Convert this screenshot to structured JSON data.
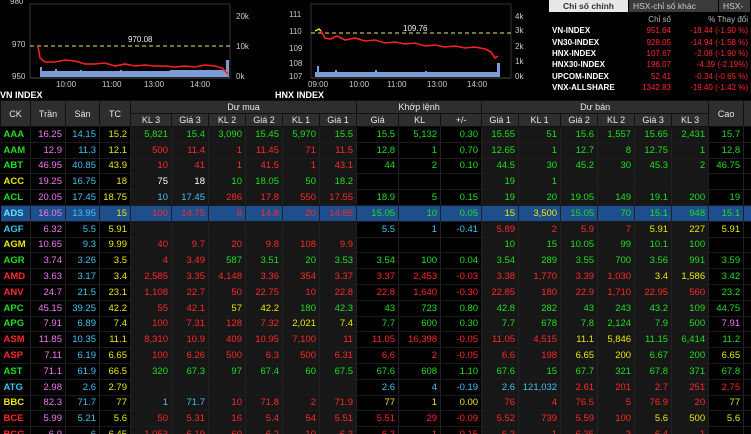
{
  "charts": [
    {
      "id": "vn",
      "label": "VN INDEX",
      "ref_value": "970.08",
      "y_left": [
        "980",
        "970",
        "960",
        "950"
      ],
      "y_right": [
        "20k",
        "15k",
        "10k",
        "5k",
        "0k"
      ],
      "x_ticks": [
        "10:00",
        "11:00",
        "13:00",
        "14:00"
      ]
    },
    {
      "id": "hnx",
      "label": "HNX INDEX",
      "ref_value": "109.76",
      "y_left": [
        "111",
        "110",
        "109",
        "108",
        "107"
      ],
      "y_right": [
        "4k",
        "3k",
        "2k",
        "1k",
        "0k"
      ],
      "x_ticks": [
        "09:00",
        "10:00",
        "11:00",
        "13:00",
        "14:00"
      ]
    }
  ],
  "index_panel": {
    "tabs": [
      "Chỉ số chính",
      "HSX-chỉ số khác",
      "HSX-"
    ],
    "headers": [
      "",
      "Chỉ số",
      "% Thay đổi"
    ],
    "rows": [
      {
        "name": "VN-INDEX",
        "value": "951.64",
        "change": "-18.44 (-1.90 %)"
      },
      {
        "name": "VN30-INDEX",
        "value": "928.05",
        "change": "-14.94 (-1.58 %)"
      },
      {
        "name": "HNX-INDEX",
        "value": "107.67",
        "change": "-2.08 (-1.90 %)"
      },
      {
        "name": "HNX30-INDEX",
        "value": "196.07",
        "change": "-4.39 (-2.19%)"
      },
      {
        "name": "UPCOM-INDEX",
        "value": "52.41",
        "change": "-0.34 (-0.65 %)"
      },
      {
        "name": "VNX-ALLSHARE",
        "value": "1342.83",
        "change": "-19.40 (-1.42 %)"
      }
    ]
  },
  "board": {
    "group_headers": {
      "buy": "Dư mua",
      "match": "Khớp lệnh",
      "sell": "Dư bán"
    },
    "col_headers": {
      "ck": "CK",
      "ceil": "Trần",
      "floor": "Sàn",
      "ref": "TC",
      "b3q": "KL 3",
      "b3p": "Giá 3",
      "b2q": "KL 2",
      "b2p": "Giá 2",
      "b1q": "KL 1",
      "b1p": "Giá 1",
      "mp": "Giá",
      "mq": "KL",
      "chg": "+/-",
      "s1p": "Giá 1",
      "s1q": "KL 1",
      "s2p": "Giá 2",
      "s2q": "KL 2",
      "s3p": "Giá 3",
      "s3q": "KL 3",
      "high": "Cao",
      "low": "T"
    },
    "rows": [
      {
        "ck": "AAA",
        "ceil": "16.25",
        "floor": "14.15",
        "ref": "15.2",
        "b3q": "5,821",
        "b3p": "15.4",
        "b2q": "3,090",
        "b2p": "15.45",
        "b1q": "5,970",
        "b1p": "15.5",
        "mp": "15.5",
        "mq": "5,132",
        "chg": "0.30",
        "s1p": "15.55",
        "s1q": "51",
        "s2p": "15.6",
        "s2q": "1,557",
        "s3p": "15.65",
        "s3q": "2,431",
        "high": "15.7",
        "low": "1",
        "c": {
          "ck": "up",
          "b3": "up",
          "b2": "up",
          "b1": "up",
          "m": "up",
          "s1": "up",
          "s2": "up",
          "s3": "up",
          "high": "up",
          "low": "up"
        }
      },
      {
        "ck": "AAM",
        "ceil": "12.9",
        "floor": "11.3",
        "ref": "12.1",
        "b3q": "500",
        "b3p": "11.4",
        "b2q": "1",
        "b2p": "11.45",
        "b1q": "71",
        "b1p": "11.5",
        "mp": "12.8",
        "mq": "1",
        "chg": "0.70",
        "s1p": "12.65",
        "s1q": "1",
        "s2p": "12.7",
        "s2q": "8",
        "s3p": "12.75",
        "s3q": "1",
        "high": "12.8",
        "low": "1",
        "c": {
          "ck": "up",
          "b3": "dn",
          "b2": "dn",
          "b1": "dn",
          "m": "up",
          "s1": "up",
          "s2": "up",
          "s3": "up",
          "high": "up",
          "low": "up"
        }
      },
      {
        "ck": "ABT",
        "ceil": "46.95",
        "floor": "40.85",
        "ref": "43.9",
        "b3q": "10",
        "b3p": "41",
        "b2q": "1",
        "b2p": "41.5",
        "b1q": "1",
        "b1p": "43.1",
        "mp": "44",
        "mq": "2",
        "chg": "0.10",
        "s1p": "44.5",
        "s1q": "30",
        "s2p": "45.2",
        "s2q": "30",
        "s3p": "45.3",
        "s3q": "2",
        "high": "46.75",
        "low": "4",
        "c": {
          "ck": "up",
          "b3": "dn",
          "b2": "dn",
          "b1": "dn",
          "m": "up",
          "s1": "up",
          "s2": "up",
          "s3": "up",
          "high": "up",
          "low": "up"
        }
      },
      {
        "ck": "ACC",
        "ceil": "19.25",
        "floor": "16.75",
        "ref": "18",
        "b3q": "75",
        "b3p": "18",
        "b2q": "10",
        "b2p": "18.05",
        "b1q": "50",
        "b1p": "18.2",
        "mp": "",
        "mq": "",
        "chg": "",
        "s1p": "19",
        "s1q": "1",
        "s2p": "",
        "s2q": "",
        "s3p": "",
        "s3q": "",
        "high": "",
        "low": "",
        "c": {
          "ck": "eq",
          "b3": "white",
          "b2": "up",
          "b1": "up",
          "m": "up",
          "s1": "up",
          "s2": "up",
          "s3": "up",
          "high": "up",
          "low": "up"
        }
      },
      {
        "ck": "ACL",
        "ceil": "20.05",
        "floor": "17.45",
        "ref": "18.75",
        "b3q": "10",
        "b3p": "17.45",
        "b2q": "286",
        "b2p": "17.8",
        "b1q": "550",
        "b1p": "17.55",
        "mp": "18.9",
        "mq": "5",
        "chg": "0.15",
        "s1p": "19",
        "s1q": "20",
        "s2p": "19.05",
        "s2q": "149",
        "s3p": "19.1",
        "s3q": "200",
        "high": "19",
        "low": "1",
        "c": {
          "ck": "up",
          "b3": "floor",
          "b2": "dn",
          "b1": "dn",
          "m": "up",
          "s1": "up",
          "s2": "up",
          "s3": "up",
          "high": "up",
          "low": "up"
        }
      },
      {
        "ck": "ADS",
        "ceil": "16.05",
        "floor": "13.95",
        "ref": "15",
        "b3q": "100",
        "b3p": "14.75",
        "b2q": "8",
        "b2p": "14.8",
        "b1q": "20",
        "b1p": "14.85",
        "mp": "15.05",
        "mq": "10",
        "chg": "0.05",
        "s1p": "15",
        "s1q": "3,500",
        "s2p": "15.05",
        "s2q": "70",
        "s3p": "15.1",
        "s3q": "948",
        "high": "15.1",
        "low": "1",
        "sel": true,
        "c": {
          "ck": "up",
          "b3": "dn",
          "b2": "dn",
          "b1": "dn",
          "m": "up",
          "s1": "eq",
          "s2": "up",
          "s3": "up",
          "high": "up",
          "low": "up"
        }
      },
      {
        "ck": "AGF",
        "ceil": "6.32",
        "floor": "5.5",
        "ref": "5.91",
        "b3q": "",
        "b3p": "",
        "b2q": "",
        "b2p": "",
        "b1q": "",
        "b1p": "",
        "mp": "5.5",
        "mq": "1",
        "chg": "-0.41",
        "s1p": "5.89",
        "s1q": "2",
        "s2p": "5.9",
        "s2q": "7",
        "s3p": "5.91",
        "s3q": "227",
        "high": "5.91",
        "low": "",
        "c": {
          "ck": "floor",
          "b3": "dn",
          "b2": "dn",
          "b1": "dn",
          "m": "floor",
          "s1": "dn",
          "s2": "dn",
          "s3": "eq",
          "high": "eq",
          "low": "eq"
        }
      },
      {
        "ck": "AGM",
        "ceil": "10.65",
        "floor": "9.3",
        "ref": "9.99",
        "b3q": "40",
        "b3p": "9.7",
        "b2q": "20",
        "b2p": "9.8",
        "b1q": "108",
        "b1p": "9.9",
        "mp": "",
        "mq": "",
        "chg": "",
        "s1p": "10",
        "s1q": "15",
        "s2p": "10.05",
        "s2q": "99",
        "s3p": "10.1",
        "s3q": "100",
        "high": "",
        "low": "",
        "c": {
          "ck": "eq",
          "b3": "dn",
          "b2": "dn",
          "b1": "dn",
          "m": "up",
          "s1": "up",
          "s2": "up",
          "s3": "up",
          "high": "up",
          "low": "up"
        }
      },
      {
        "ck": "AGR",
        "ceil": "3.74",
        "floor": "3.26",
        "ref": "3.5",
        "b3q": "4",
        "b3p": "3.49",
        "b2q": "587",
        "b2p": "3.51",
        "b1q": "20",
        "b1p": "3.53",
        "mp": "3.54",
        "mq": "100",
        "chg": "0.04",
        "s1p": "3.54",
        "s1q": "289",
        "s2p": "3.55",
        "s2q": "700",
        "s3p": "3.56",
        "s3q": "991",
        "high": "3.59",
        "low": "3",
        "c": {
          "ck": "up",
          "b3": "dn",
          "b2": "up",
          "b1": "up",
          "m": "up",
          "s1": "up",
          "s2": "up",
          "s3": "up",
          "high": "up",
          "low": "up"
        }
      },
      {
        "ck": "AMD",
        "ceil": "3.63",
        "floor": "3.17",
        "ref": "3.4",
        "b3q": "2,585",
        "b3p": "3.35",
        "b2q": "4,148",
        "b2p": "3.36",
        "b1q": "354",
        "b1p": "3.37",
        "mp": "3.37",
        "mq": "2,453",
        "chg": "-0.03",
        "s1p": "3.38",
        "s1q": "1,770",
        "s2p": "3.39",
        "s2q": "1,030",
        "s3p": "3.4",
        "s3q": "1,586",
        "high": "3.42",
        "low": "3",
        "c": {
          "ck": "dn",
          "b3": "dn",
          "b2": "dn",
          "b1": "dn",
          "m": "dn",
          "s1": "dn",
          "s2": "dn",
          "s3": "eq",
          "high": "up",
          "low": "dn"
        }
      },
      {
        "ck": "ANV",
        "ceil": "24.7",
        "floor": "21.5",
        "ref": "23.1",
        "b3q": "1,108",
        "b3p": "22.7",
        "b2q": "50",
        "b2p": "22.75",
        "b1q": "10",
        "b1p": "22.8",
        "mp": "22.8",
        "mq": "1,640",
        "chg": "-0.30",
        "s1p": "22.85",
        "s1q": "180",
        "s2p": "22.9",
        "s2q": "1,710",
        "s3p": "22.95",
        "s3q": "560",
        "high": "23.2",
        "low": "2",
        "c": {
          "ck": "dn",
          "b3": "dn",
          "b2": "dn",
          "b1": "dn",
          "m": "dn",
          "s1": "dn",
          "s2": "dn",
          "s3": "dn",
          "high": "up",
          "low": "dn"
        }
      },
      {
        "ck": "APC",
        "ceil": "45.15",
        "floor": "39.25",
        "ref": "42.2",
        "b3q": "55",
        "b3p": "42.1",
        "b2q": "57",
        "b2p": "42.2",
        "b1q": "180",
        "b1p": "42.3",
        "mp": "43",
        "mq": "723",
        "chg": "0.80",
        "s1p": "42.8",
        "s1q": "282",
        "s2p": "43",
        "s2q": "243",
        "s3p": "43.2",
        "s3q": "109",
        "high": "44.75",
        "low": "4",
        "c": {
          "ck": "up",
          "b3": "dn",
          "b2": "eq",
          "b1": "up",
          "m": "up",
          "s1": "up",
          "s2": "up",
          "s3": "up",
          "high": "up",
          "low": "up"
        }
      },
      {
        "ck": "APG",
        "ceil": "7.91",
        "floor": "6.89",
        "ref": "7.4",
        "b3q": "100",
        "b3p": "7.31",
        "b2q": "128",
        "b2p": "7.32",
        "b1q": "2,021",
        "b1p": "7.4",
        "mp": "7.7",
        "mq": "600",
        "chg": "0.30",
        "s1p": "7.7",
        "s1q": "678",
        "s2p": "7.8",
        "s2q": "2,124",
        "s3p": "7.9",
        "s3q": "500",
        "high": "7.91",
        "low": "7",
        "c": {
          "ck": "up",
          "b3": "dn",
          "b2": "dn",
          "b1": "eq",
          "m": "up",
          "s1": "up",
          "s2": "up",
          "s3": "up",
          "high": "ceil",
          "low": "up"
        }
      },
      {
        "ck": "ASM",
        "ceil": "11.85",
        "floor": "10.35",
        "ref": "11.1",
        "b3q": "8,310",
        "b3p": "10.9",
        "b2q": "409",
        "b2p": "10.95",
        "b1q": "7,100",
        "b1p": "11",
        "mp": "11.05",
        "mq": "16,398",
        "chg": "-0.05",
        "s1p": "11.05",
        "s1q": "4,515",
        "s2p": "11.1",
        "s2q": "5,846",
        "s3p": "11.15",
        "s3q": "6,414",
        "high": "11.2",
        "low": "1",
        "c": {
          "ck": "dn",
          "b3": "dn",
          "b2": "dn",
          "b1": "dn",
          "m": "dn",
          "s1": "dn",
          "s2": "eq",
          "s3": "up",
          "high": "up",
          "low": "dn"
        }
      },
      {
        "ck": "ASP",
        "ceil": "7.11",
        "floor": "6.19",
        "ref": "6.65",
        "b3q": "100",
        "b3p": "6.26",
        "b2q": "500",
        "b2p": "6.3",
        "b1q": "500",
        "b1p": "6.31",
        "mp": "6.6",
        "mq": "2",
        "chg": "-0.05",
        "s1p": "6.6",
        "s1q": "198",
        "s2p": "6.65",
        "s2q": "200",
        "s3p": "6.67",
        "s3q": "200",
        "high": "6.65",
        "low": "6",
        "c": {
          "ck": "dn",
          "b3": "dn",
          "b2": "dn",
          "b1": "dn",
          "m": "dn",
          "s1": "dn",
          "s2": "eq",
          "s3": "up",
          "high": "eq",
          "low": "dn"
        }
      },
      {
        "ck": "AST",
        "ceil": "71.1",
        "floor": "61.9",
        "ref": "66.5",
        "b3q": "320",
        "b3p": "67.3",
        "b2q": "97",
        "b2p": "67.4",
        "b1q": "60",
        "b1p": "67.5",
        "mp": "67.6",
        "mq": "608",
        "chg": "1.10",
        "s1p": "67.6",
        "s1q": "15",
        "s2p": "67.7",
        "s2q": "321",
        "s3p": "67.8",
        "s3q": "371",
        "high": "67.8",
        "low": "6",
        "c": {
          "ck": "up",
          "b3": "up",
          "b2": "up",
          "b1": "up",
          "m": "up",
          "s1": "up",
          "s2": "up",
          "s3": "up",
          "high": "up",
          "low": "up"
        }
      },
      {
        "ck": "ATG",
        "ceil": "2.98",
        "floor": "2.6",
        "ref": "2.79",
        "b3q": "",
        "b3p": "",
        "b2q": "",
        "b2p": "",
        "b1q": "",
        "b1p": "",
        "mp": "2.6",
        "mq": "4",
        "chg": "-0.19",
        "s1p": "2.6",
        "s1q": "121,032",
        "s2p": "2.61",
        "s2q": "201",
        "s3p": "2.7",
        "s3q": "251",
        "high": "2.75",
        "low": "",
        "c": {
          "ck": "floor",
          "b3": "dn",
          "b2": "dn",
          "b1": "dn",
          "m": "floor",
          "s1": "floor",
          "s2": "dn",
          "s3": "dn",
          "high": "dn",
          "low": "dn"
        }
      },
      {
        "ck": "BBC",
        "ceil": "82.3",
        "floor": "71.7",
        "ref": "77",
        "b3q": "1",
        "b3p": "71.7",
        "b2q": "10",
        "b2p": "71.8",
        "b1q": "2",
        "b1p": "71.9",
        "mp": "77",
        "mq": "1",
        "chg": "0.00",
        "s1p": "76",
        "s1q": "4",
        "s2p": "76.5",
        "s2q": "5",
        "s3p": "76.9",
        "s3q": "20",
        "high": "77",
        "low": "",
        "c": {
          "ck": "eq",
          "b3": "floor",
          "b2": "dn",
          "b1": "dn",
          "m": "eq",
          "s1": "dn",
          "s2": "dn",
          "s3": "dn",
          "high": "eq",
          "low": "eq"
        }
      },
      {
        "ck": "BCE",
        "ceil": "5.99",
        "floor": "5.21",
        "ref": "5.6",
        "b3q": "50",
        "b3p": "5.31",
        "b2q": "16",
        "b2p": "5.4",
        "b1q": "54",
        "b1p": "5.51",
        "mp": "5.51",
        "mq": "29",
        "chg": "-0.09",
        "s1p": "5.52",
        "s1q": "739",
        "s2p": "5.59",
        "s2q": "100",
        "s3p": "5.6",
        "s3q": "500",
        "high": "5.6",
        "low": "5",
        "c": {
          "ck": "dn",
          "b3": "dn",
          "b2": "dn",
          "b1": "dn",
          "m": "dn",
          "s1": "dn",
          "s2": "dn",
          "s3": "eq",
          "high": "eq",
          "low": "dn"
        }
      },
      {
        "ck": "BCG",
        "ceil": "6.9",
        "floor": "6",
        "ref": "6.45",
        "b3q": "1,053",
        "b3p": "6.19",
        "b2q": "60",
        "b2p": "6.2",
        "b1q": "10",
        "b1p": "6.3",
        "mp": "6.3",
        "mq": "1",
        "chg": "-0.15",
        "s1p": "6.3",
        "s1q": "1",
        "s2p": "6.35",
        "s2q": "3",
        "s3p": "6.4",
        "s3q": "1",
        "high": "",
        "low": "",
        "c": {
          "ck": "dn",
          "b3": "dn",
          "b2": "dn",
          "b1": "dn",
          "m": "dn",
          "s1": "dn",
          "s2": "dn",
          "s3": "dn",
          "high": "dn",
          "low": "dn"
        }
      }
    ]
  }
}
